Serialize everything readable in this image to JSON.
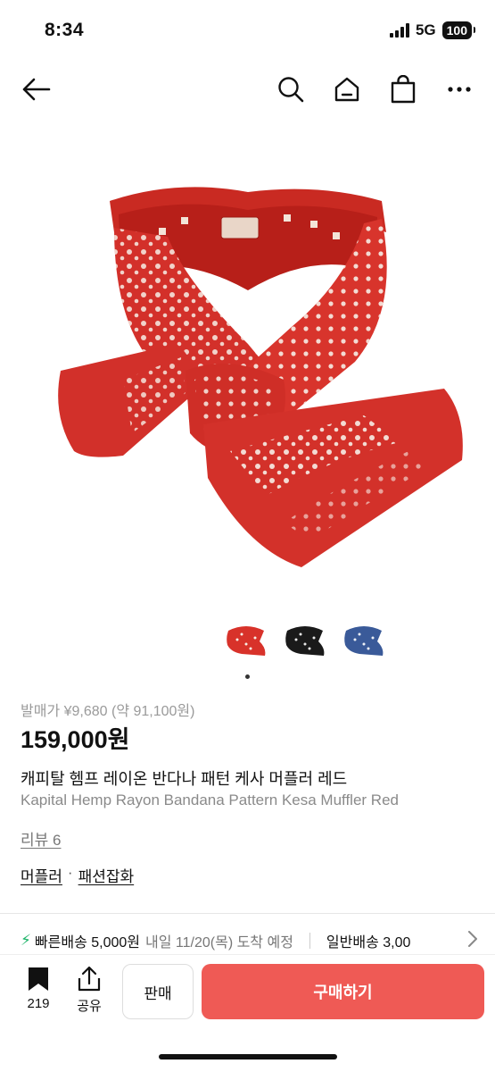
{
  "status_bar": {
    "time": "8:34",
    "network": "5G",
    "battery": "100"
  },
  "nav": {
    "back_icon": "arrow-left-icon",
    "search_icon": "search-icon",
    "home_icon": "home-icon",
    "bag_icon": "shopping-bag-icon",
    "more_icon": "more-horizontal-icon"
  },
  "gallery": {
    "thumbnail_count": 3,
    "active_index": 0,
    "colors": [
      "#d8322a",
      "#1a1a1a",
      "#3a5a99"
    ]
  },
  "product": {
    "release_price": "발매가 ¥9,680 (약 91,100원)",
    "price": "159,000원",
    "title_ko": "캐피탈 헴프 레이온 반다나 패턴 케사 머플러 레드",
    "title_en": "Kapital Hemp Rayon Bandana Pattern Kesa Muffler Red",
    "review": "리뷰 6",
    "category_1": "머플러",
    "category_sep": "·",
    "category_2": "패션잡화"
  },
  "shipping": {
    "fast": "빠른배송 5,000원",
    "fast_date": "내일 11/20(목) 도착 예정",
    "normal": "일반배송 3,00"
  },
  "bottom_bar": {
    "bookmark_count": "219",
    "share_label": "공유",
    "sell_label": "판매",
    "buy_label": "구매하기"
  },
  "colors": {
    "accent": "#ef5a55",
    "fast_ship": "#1fb56a"
  }
}
